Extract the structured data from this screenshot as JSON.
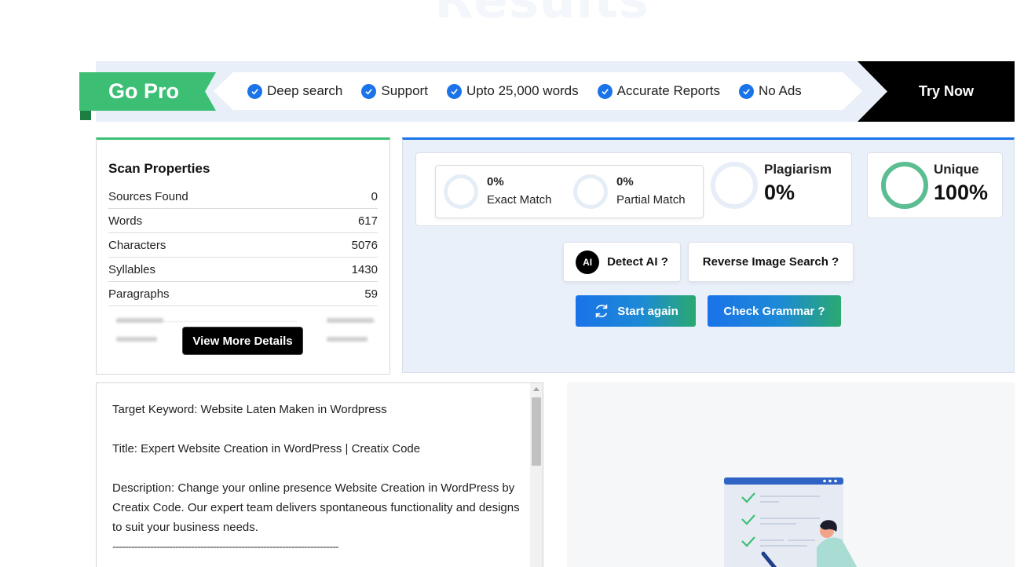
{
  "page": {
    "ghost_heading": "Results"
  },
  "banner": {
    "go_pro_label": "Go Pro",
    "features": [
      "Deep search",
      "Support",
      "Upto 25,000 words",
      "Accurate Reports",
      "No Ads"
    ],
    "try_now_label": "Try Now",
    "colors": {
      "go_pro": "#3cbf75",
      "check": "#1a73e8",
      "try_now_bg": "#000000"
    }
  },
  "scan_properties": {
    "title": "Scan Properties",
    "rows": [
      {
        "label": "Sources Found",
        "value": "0"
      },
      {
        "label": "Words",
        "value": "617"
      },
      {
        "label": "Characters",
        "value": "5076"
      },
      {
        "label": "Syllables",
        "value": "1430"
      },
      {
        "label": "Paragraphs",
        "value": "59"
      }
    ],
    "view_more_label": "View More Details"
  },
  "results": {
    "exact_match": {
      "value": "0%",
      "label": "Exact Match"
    },
    "partial_match": {
      "value": "0%",
      "label": "Partial Match"
    },
    "plagiarism": {
      "label": "Plagiarism",
      "value": "0%"
    },
    "unique": {
      "label": "Unique",
      "value": "100%"
    },
    "detect_ai_label": "Detect AI ?",
    "detect_ai_badge": "AI",
    "reverse_image_label": "Reverse Image Search ?",
    "start_again_label": "Start again",
    "check_grammar_label": "Check Grammar ?",
    "colors": {
      "unique_ring": "#5bbd92",
      "accent": "#1a73e8"
    }
  },
  "text_pane": {
    "keyword_line": "Target Keyword:  Website Laten Maken in Wordpress",
    "title_line": "Title: Expert Website Creation in WordPress | Creatix Code",
    "description_line": "Description: Change your online presence Website Creation in WordPress by Creatix Code. Our expert team delivers spontaneous functionality and designs to suit your business needs.",
    "separator": "------------------------------------------------------------------------"
  }
}
